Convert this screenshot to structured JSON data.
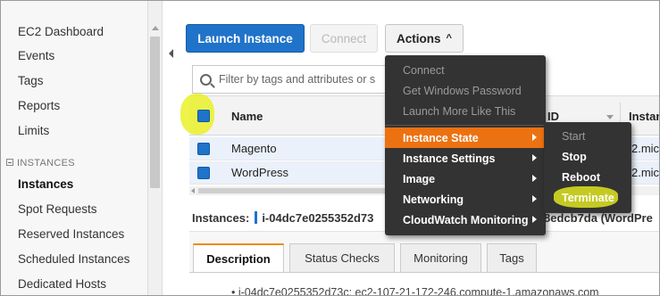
{
  "sidebar": {
    "items": [
      {
        "label": "EC2 Dashboard"
      },
      {
        "label": "Events"
      },
      {
        "label": "Tags"
      },
      {
        "label": "Reports"
      },
      {
        "label": "Limits"
      }
    ],
    "section_label": "INSTANCES",
    "section_items": [
      {
        "label": "Instances",
        "active": true
      },
      {
        "label": "Spot Requests"
      },
      {
        "label": "Reserved Instances"
      },
      {
        "label": "Scheduled Instances"
      },
      {
        "label": "Dedicated Hosts"
      }
    ]
  },
  "toolbar": {
    "launch_label": "Launch Instance",
    "connect_label": "Connect",
    "actions_label": "Actions",
    "actions_caret": "^"
  },
  "filter": {
    "placeholder": "Filter by tags and attributes or s"
  },
  "table": {
    "columns": {
      "name": "Name",
      "id": "ID",
      "type": "Instan"
    },
    "rows": [
      {
        "name": "Magento",
        "type": "2.mic"
      },
      {
        "name": "WordPress",
        "type": "2.mic"
      }
    ]
  },
  "instances_line": {
    "label": "Instances:",
    "value": "i-04dc7e0255352d73",
    "tail": "8edcb7da (WordPre"
  },
  "details": {
    "tabs": [
      {
        "label": "Description",
        "active": true
      },
      {
        "label": "Status Checks"
      },
      {
        "label": "Monitoring"
      },
      {
        "label": "Tags"
      }
    ],
    "first_line": "• i-04dc7e0255352d73c: ec2-107-21-172-246.compute-1.amazonaws.com"
  },
  "actions_menu": {
    "items": [
      {
        "label": "Connect",
        "enabled": false
      },
      {
        "label": "Get Windows Password",
        "enabled": false
      },
      {
        "label": "Launch More Like This",
        "enabled": false
      },
      {
        "label": "Instance State",
        "enabled": true,
        "active": true,
        "submenu": true
      },
      {
        "label": "Instance Settings",
        "enabled": true,
        "submenu": true
      },
      {
        "label": "Image",
        "enabled": true,
        "submenu": true
      },
      {
        "label": "Networking",
        "enabled": true,
        "submenu": true
      },
      {
        "label": "CloudWatch Monitoring",
        "enabled": true,
        "submenu": true
      }
    ]
  },
  "state_submenu": {
    "items": [
      {
        "label": "Start",
        "enabled": false
      },
      {
        "label": "Stop",
        "enabled": true
      },
      {
        "label": "Reboot",
        "enabled": true
      },
      {
        "label": "Terminate",
        "enabled": true,
        "highlighted": true
      }
    ]
  },
  "colors": {
    "primary_button": "#1f73c9",
    "menu_bg": "#333333",
    "menu_active": "#ec7211",
    "tab_accent": "#ec8b0b",
    "annotation_highlight": "#e8f014"
  }
}
